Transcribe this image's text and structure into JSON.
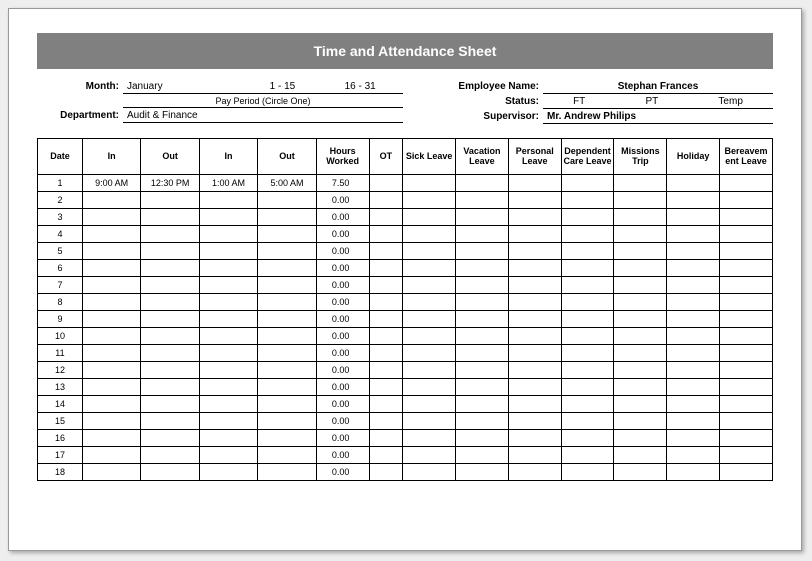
{
  "banner_title": "Time and Attendance Sheet",
  "labels": {
    "month": "Month:",
    "department": "Department:",
    "pay_period_hint": "Pay Period (Circle One)",
    "employee_name": "Employee Name:",
    "status": "Status:",
    "supervisor": "Supervisor:"
  },
  "month": {
    "name": "January",
    "period1": "1 - 15",
    "period2": "16 - 31"
  },
  "department": "Audit & Finance",
  "employee_name": "Stephan Frances",
  "status_options": {
    "ft": "FT",
    "pt": "PT",
    "temp": "Temp"
  },
  "supervisor": "Mr. Andrew Philips",
  "columns": {
    "date": "Date",
    "in1": "In",
    "out1": "Out",
    "in2": "In",
    "out2": "Out",
    "hours": "Hours Worked",
    "ot": "OT",
    "sick": "Sick Leave",
    "vacation": "Vacation Leave",
    "personal": "Personal Leave",
    "dependent": "Dependent Care Leave",
    "missions": "Missions Trip",
    "holiday": "Holiday",
    "bereave": "Bereavem ent Leave"
  },
  "rows": [
    {
      "date": "1",
      "in1": "9:00 AM",
      "out1": "12:30 PM",
      "in2": "1:00 AM",
      "out2": "5:00 AM",
      "hours": "7.50"
    },
    {
      "date": "2",
      "hours": "0.00"
    },
    {
      "date": "3",
      "hours": "0.00"
    },
    {
      "date": "4",
      "hours": "0.00"
    },
    {
      "date": "5",
      "hours": "0.00"
    },
    {
      "date": "6",
      "hours": "0.00"
    },
    {
      "date": "7",
      "hours": "0.00"
    },
    {
      "date": "8",
      "hours": "0.00"
    },
    {
      "date": "9",
      "hours": "0.00"
    },
    {
      "date": "10",
      "hours": "0.00"
    },
    {
      "date": "11",
      "hours": "0.00"
    },
    {
      "date": "12",
      "hours": "0.00"
    },
    {
      "date": "13",
      "hours": "0.00"
    },
    {
      "date": "14",
      "hours": "0.00"
    },
    {
      "date": "15",
      "hours": "0.00"
    },
    {
      "date": "16",
      "hours": "0.00"
    },
    {
      "date": "17",
      "hours": "0.00"
    },
    {
      "date": "18",
      "hours": "0.00"
    }
  ]
}
